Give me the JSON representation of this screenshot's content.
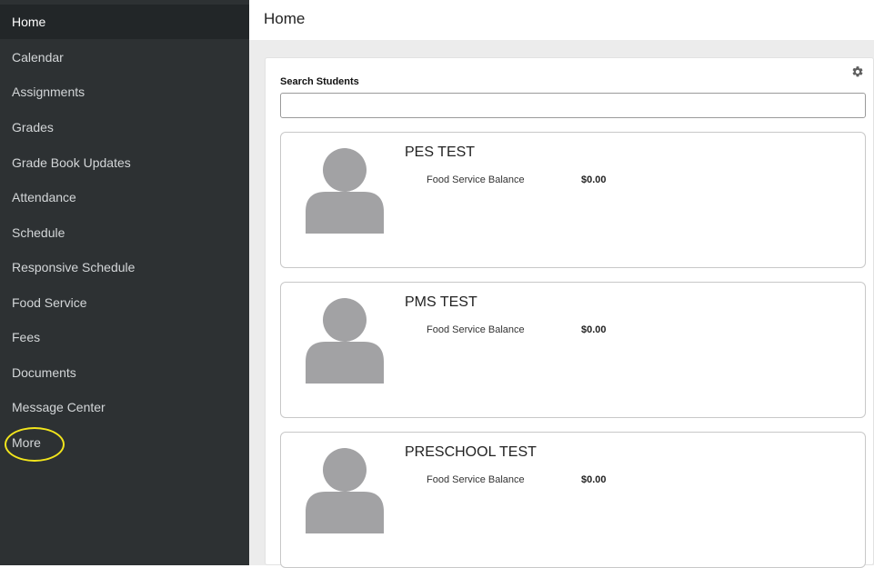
{
  "sidebar": {
    "items": [
      {
        "label": "Home"
      },
      {
        "label": "Calendar"
      },
      {
        "label": "Assignments"
      },
      {
        "label": "Grades"
      },
      {
        "label": "Grade Book Updates"
      },
      {
        "label": "Attendance"
      },
      {
        "label": "Schedule"
      },
      {
        "label": "Responsive Schedule"
      },
      {
        "label": "Food Service"
      },
      {
        "label": "Fees"
      },
      {
        "label": "Documents"
      },
      {
        "label": "Message Center"
      },
      {
        "label": "More"
      }
    ],
    "active": "Home",
    "highlighted": "More"
  },
  "header": {
    "title": "Home"
  },
  "search": {
    "label": "Search Students",
    "value": "",
    "placeholder": ""
  },
  "students": [
    {
      "name": "PES TEST",
      "balance_label": "Food Service Balance",
      "balance": "$0.00"
    },
    {
      "name": "PMS TEST",
      "balance_label": "Food Service Balance",
      "balance": "$0.00"
    },
    {
      "name": "PRESCHOOL TEST",
      "balance_label": "Food Service Balance",
      "balance": "$0.00"
    }
  ],
  "icons": {
    "settings": "gear-icon",
    "avatar": "person-silhouette-icon"
  },
  "colors": {
    "sidebar_bg": "#2d3133",
    "sidebar_active_bg": "#222628",
    "highlight_ring": "#f2e51c",
    "avatar_gray": "#a2a2a4",
    "main_bg": "#ececec"
  }
}
